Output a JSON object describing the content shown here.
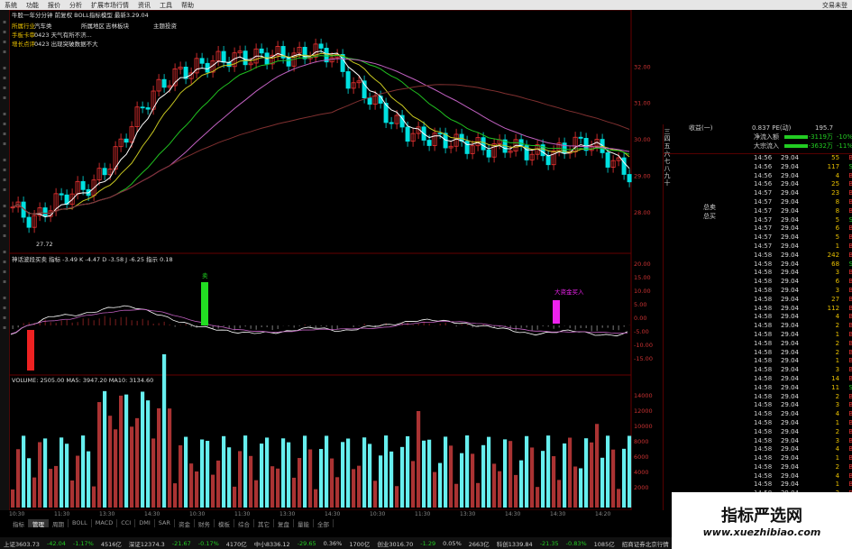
{
  "menu": {
    "items": [
      "系统",
      "功能",
      "报价",
      "分析",
      "扩展市场行情",
      "资讯",
      "工具",
      "帮助"
    ],
    "right": "交易未登"
  },
  "header": {
    "line1": "牛股一年分分钟 前复权 BOLL指标模型 最新3.29.04",
    "sector_rows": [
      {
        "k": "所属行业",
        "v": "汽车类",
        "k2": "所属地区",
        "v2": "吉林板块",
        "k3": "主题投资"
      },
      {
        "k": "手板卡审",
        "v": "0423 天气有所不济..."
      },
      {
        "k": "增长点评",
        "v": "0423 出现突破数据不大"
      }
    ]
  },
  "main_chart": {
    "low_label": "27.72",
    "y_ticks": [
      "32.00",
      "31.00",
      "30.00",
      "29.00",
      "28.00"
    ]
  },
  "macd": {
    "title": "神话波段买卖 指标 -3.49 K -4.47 D -3.58 J -6.25 指示 0.18",
    "label_buy": "卖",
    "label_sell": "大资金买入",
    "y_ticks": [
      "20.00",
      "15.00",
      "10.00",
      "5.00",
      "0.00",
      "-5.00",
      "-10.00",
      "-15.00"
    ]
  },
  "volume": {
    "title": "VOLUME: 2505.00 MA5: 3947.20 MA10: 3134.60",
    "y_ticks": [
      "14000",
      "12000",
      "10000",
      "8000",
      "6000",
      "4000",
      "2000"
    ]
  },
  "xaxis": [
    "10:30",
    "11:30",
    "13:30",
    "14:30",
    "10:30",
    "11:30",
    "13:30",
    "14:30",
    "10:30",
    "11:30",
    "13:30",
    "14:30",
    "14:30",
    "14:20"
  ],
  "tabs": [
    "指标",
    "管理",
    "周期",
    "BOLL",
    "MACD",
    "CCI",
    "DMI",
    "SAR",
    "资金",
    "财务",
    "模板",
    "综合",
    "其它",
    "复盘",
    "量能",
    "全部"
  ],
  "quote_panel": {
    "title": "收益(一)",
    "pe_label": "0.837 PE(动)",
    "pe_val": "195.7",
    "flows": [
      {
        "label": "净流入额",
        "val": "-3119万",
        "pct": "-10%"
      },
      {
        "label": "大宗流入",
        "val": "-3632万",
        "pct": "-11%"
      }
    ],
    "side_labels": "三四五六七八九十",
    "bidask": [
      "总卖",
      "总买"
    ],
    "ticks": [
      [
        "14:56",
        "29.04",
        "55",
        "B"
      ],
      [
        "14:56",
        "29.04",
        "117",
        "S"
      ],
      [
        "14:56",
        "29.04",
        "4",
        "B"
      ],
      [
        "14:56",
        "29.04",
        "25",
        "B"
      ],
      [
        "14:57",
        "29.04",
        "23",
        "B"
      ],
      [
        "14:57",
        "29.04",
        "8",
        "B"
      ],
      [
        "14:57",
        "29.04",
        "8",
        "B"
      ],
      [
        "14:57",
        "29.04",
        "5",
        "S"
      ],
      [
        "14:57",
        "29.04",
        "6",
        "B"
      ],
      [
        "14:57",
        "29.04",
        "5",
        "B"
      ],
      [
        "14:57",
        "29.04",
        "1",
        "B"
      ],
      [
        "14:58",
        "29.04",
        "242",
        "B"
      ],
      [
        "14:58",
        "29.04",
        "68",
        "S"
      ],
      [
        "14:58",
        "29.04",
        "3",
        "B"
      ],
      [
        "14:58",
        "29.04",
        "6",
        "B"
      ],
      [
        "14:58",
        "29.04",
        "3",
        "B"
      ],
      [
        "14:58",
        "29.04",
        "27",
        "B"
      ],
      [
        "14:58",
        "29.04",
        "112",
        "B"
      ],
      [
        "14:58",
        "29.04",
        "4",
        "B"
      ],
      [
        "14:58",
        "29.04",
        "2",
        "B"
      ],
      [
        "14:58",
        "29.04",
        "1",
        "B"
      ],
      [
        "14:58",
        "29.04",
        "2",
        "B"
      ],
      [
        "14:58",
        "29.04",
        "2",
        "B"
      ],
      [
        "14:58",
        "29.04",
        "1",
        "B"
      ],
      [
        "14:58",
        "29.04",
        "3",
        "B"
      ],
      [
        "14:58",
        "29.04",
        "14",
        "B"
      ],
      [
        "14:58",
        "29.04",
        "11",
        "S"
      ],
      [
        "14:58",
        "29.04",
        "2",
        "B"
      ],
      [
        "14:58",
        "29.04",
        "3",
        "B"
      ],
      [
        "14:58",
        "29.04",
        "4",
        "B"
      ],
      [
        "14:58",
        "29.04",
        "1",
        "B"
      ],
      [
        "14:58",
        "29.04",
        "2",
        "B"
      ],
      [
        "14:58",
        "29.04",
        "3",
        "B"
      ],
      [
        "14:58",
        "29.04",
        "4",
        "B"
      ],
      [
        "14:58",
        "29.04",
        "1",
        "B"
      ],
      [
        "14:58",
        "29.04",
        "2",
        "B"
      ],
      [
        "14:58",
        "29.04",
        "4",
        "B"
      ],
      [
        "14:58",
        "29.04",
        "1",
        "B"
      ],
      [
        "14:58",
        "29.04",
        "2",
        "B"
      ]
    ]
  },
  "status": [
    "上证3603.73",
    "-42.04",
    "-1.17%",
    "4516亿",
    "深证12374.3",
    "-21.67",
    "-0.17%",
    "4170亿",
    "中小8336.12",
    "-29.65",
    "0.36%",
    "1700亿",
    "创业3016.70",
    "-1.29",
    "0.05%",
    "2663亿",
    "科创1339.84",
    "-21.35",
    "-0.83%",
    "1085亿",
    "招商证券北京行情"
  ],
  "watermark": {
    "title": "指标严选网",
    "url": "www.xuezhibiao.com"
  },
  "colors": {
    "up": "#e33",
    "down": "#00e0e0",
    "ma1": "#ffffff",
    "ma2": "#c8c820",
    "ma3": "#20c020",
    "ma4": "#c060c0",
    "ma5": "#803030"
  }
}
